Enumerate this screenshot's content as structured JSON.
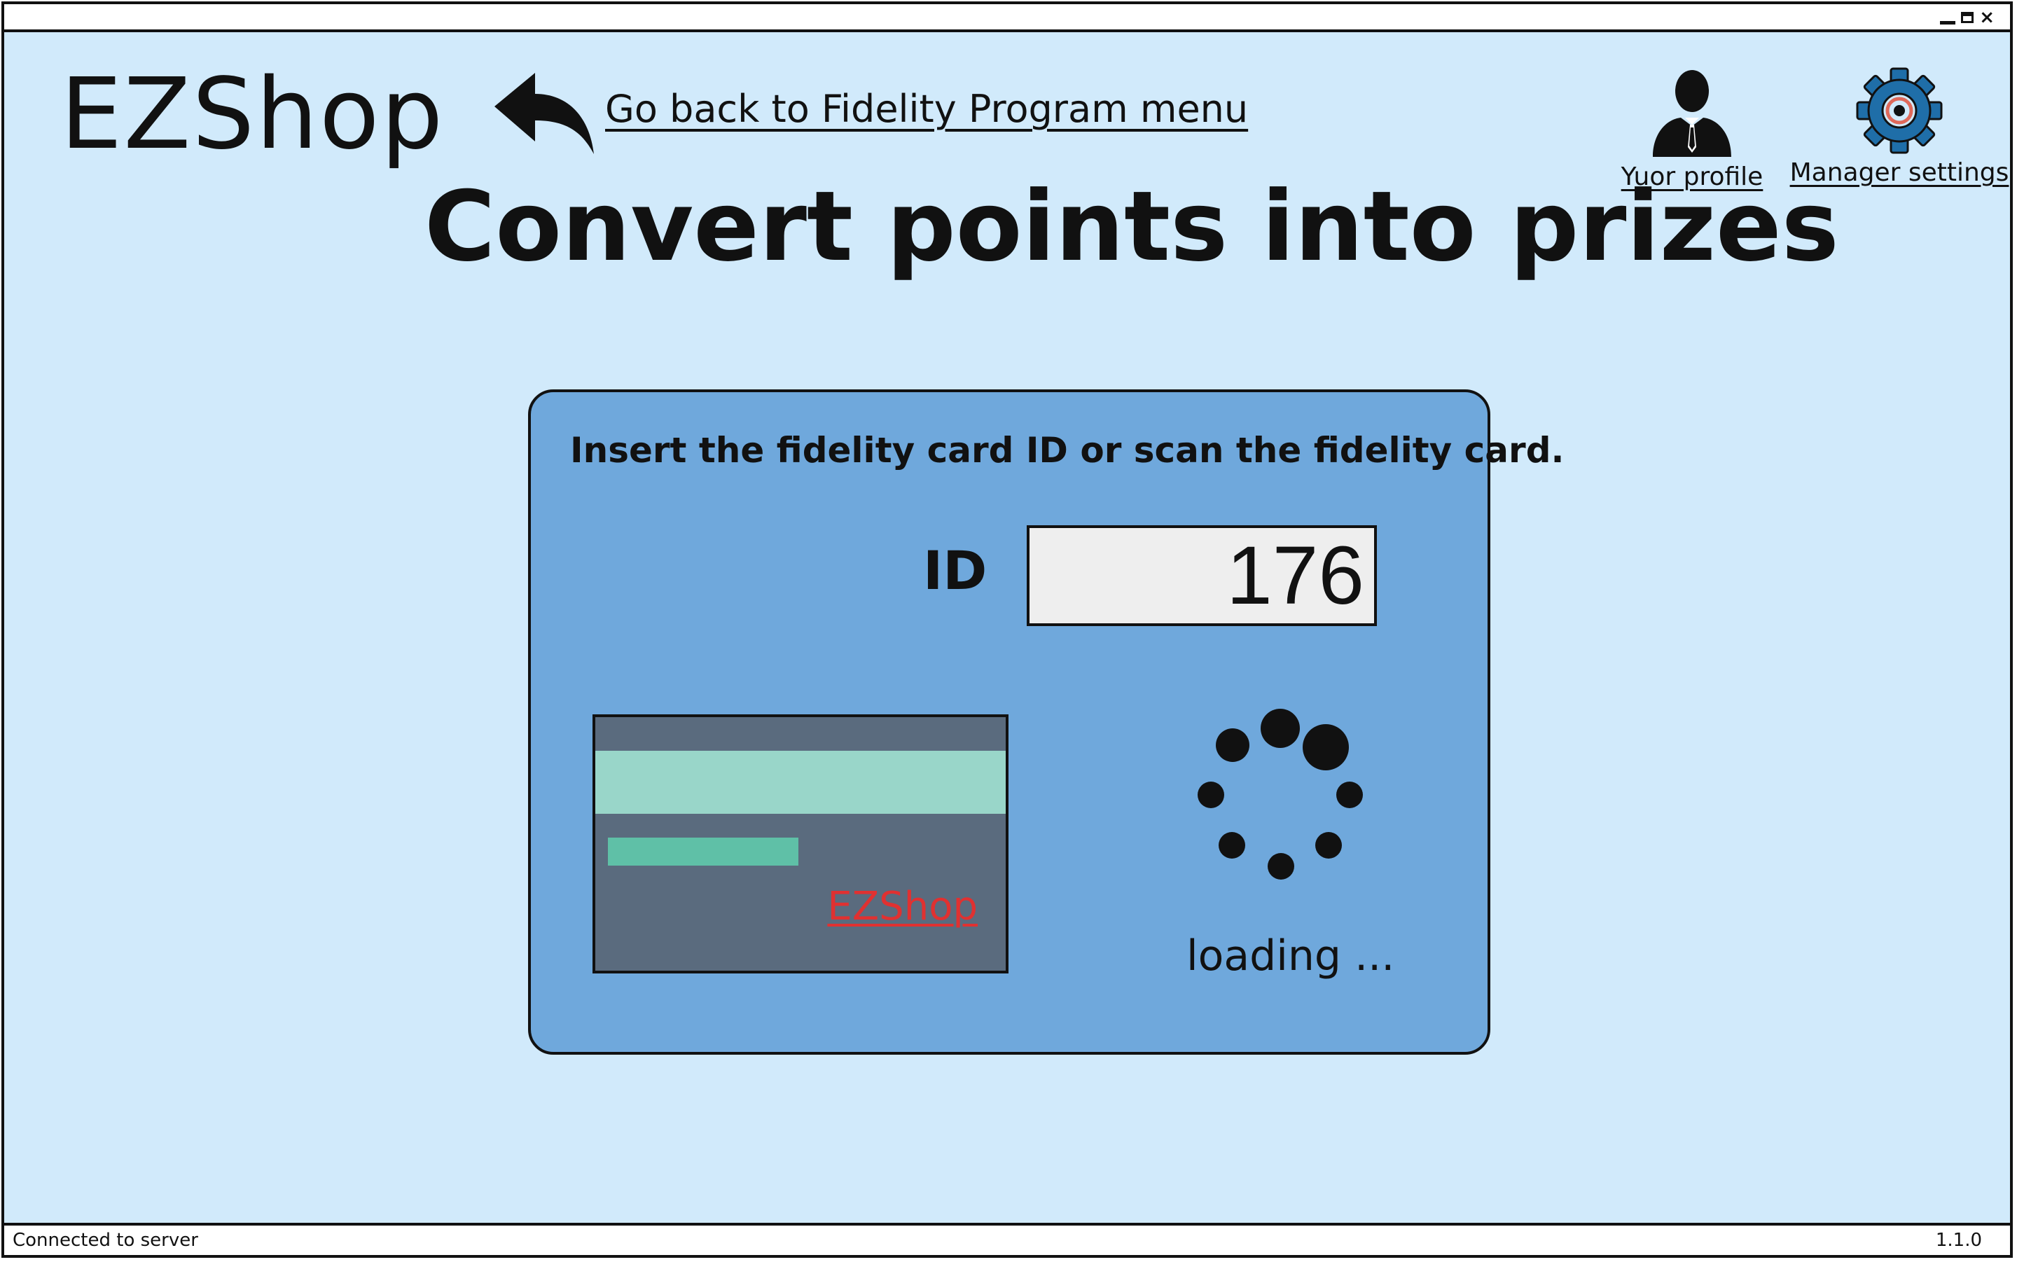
{
  "window": {
    "controls": {
      "minimize_icon": "minimize-icon",
      "maximize_icon": "maximize-icon",
      "close_label": "×"
    }
  },
  "header": {
    "logo": "EZShop",
    "back_link": "Go back to Fidelity Program menu",
    "back_icon": "back-arrow-icon",
    "nav": {
      "profile_label": "Yuor profile",
      "profile_icon": "user-profile-icon",
      "settings_label": "Manager settings",
      "settings_icon": "gear-icon"
    }
  },
  "main": {
    "title": "Convert points into prizes",
    "panel": {
      "instruction": "Insert the fidelity card ID or scan the fidelity card.",
      "id_label": "ID",
      "id_value": "176",
      "card": {
        "brand": "EZShop"
      },
      "loading_text": "loading ..."
    }
  },
  "statusbar": {
    "left": "Connected to server",
    "right": "1.1.0"
  },
  "colors": {
    "window_bg": "#d1eafb",
    "panel_bg": "#6fa8dc",
    "card_bg": "#5a6b7e",
    "card_stripe": "#99d6c9",
    "card_chip": "#5fc0a7",
    "card_brand": "#e03131",
    "gear_blue": "#1f6ea8",
    "gear_ring": "#e0695a"
  }
}
